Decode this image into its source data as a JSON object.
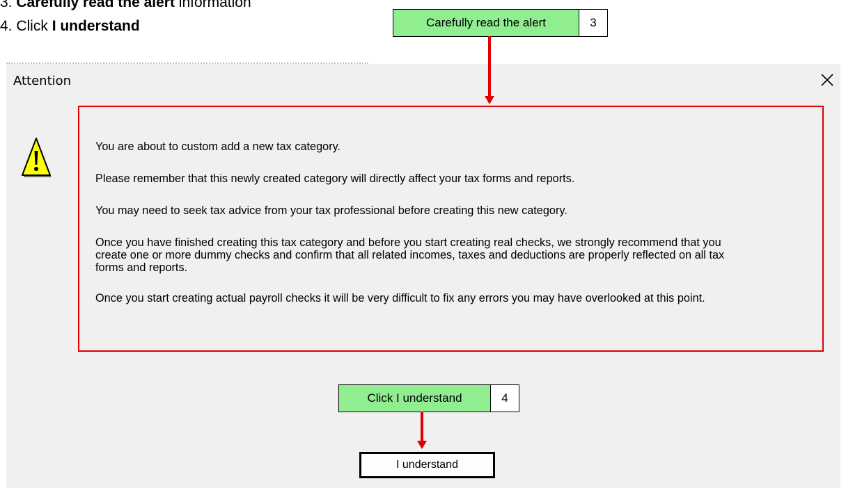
{
  "instructions": {
    "step3_num": "3.",
    "step3_bold": "Carefully read the alert",
    "step3_rest": " information",
    "step4_num": "4.",
    "step4_pre": " Click ",
    "step4_bold": "I understand"
  },
  "callouts": [
    {
      "label": "Carefully read the alert",
      "number": "3"
    },
    {
      "label": "Click I understand",
      "number": "4"
    }
  ],
  "dialog": {
    "title": "Attention",
    "messages": [
      "You are about to custom add a new tax category.",
      "Please remember that this newly created category will directly affect your tax forms and reports.",
      "You may need to seek tax advice from your tax professional before creating this new category.",
      "Once you have finished creating this tax category and before you start creating real checks, we strongly recommend that you create one or more dummy checks and confirm that all related incomes, taxes and deductions are properly reflected on all tax forms and reports.",
      "Once you start creating actual payroll checks it will be very difficult to fix any errors you may have overlooked at this point."
    ],
    "button_label": "I understand"
  },
  "icons": {
    "warning": "warning-icon",
    "close": "close-icon"
  },
  "colors": {
    "callout_fill": "#90ee90",
    "annotation_red": "#e00000",
    "dialog_bg": "#f0f0f0",
    "warning_yellow": "#ffff00"
  }
}
